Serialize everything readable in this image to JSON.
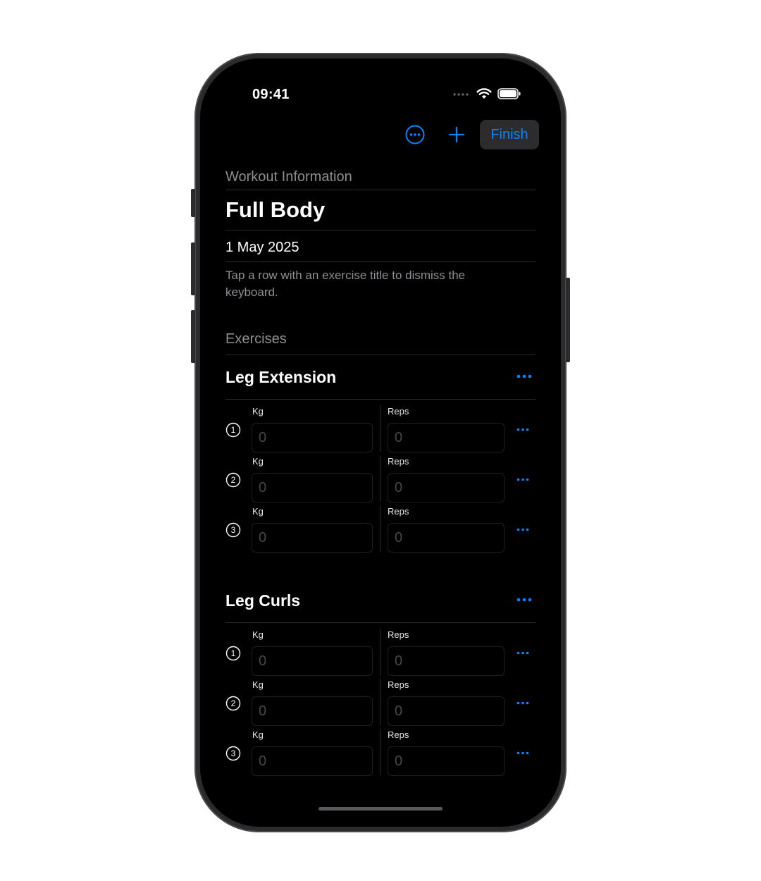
{
  "status_bar": {
    "time": "09:41"
  },
  "toolbar": {
    "finish_label": "Finish",
    "more_icon": "ellipsis-circle-icon",
    "add_icon": "plus-icon",
    "accent": "#0a84ff"
  },
  "workout": {
    "section_header": "Workout Information",
    "title": "Full Body",
    "date": "1 May 2025",
    "hint": "Tap a row with an exercise title to dismiss the keyboard."
  },
  "exercises_header": "Exercises",
  "exercises": [
    {
      "name": "Leg Extension",
      "sets": [
        {
          "number": "1",
          "kg_label": "Kg",
          "kg_placeholder": "0",
          "reps_label": "Reps",
          "reps_placeholder": "0"
        },
        {
          "number": "2",
          "kg_label": "Kg",
          "kg_placeholder": "0",
          "reps_label": "Reps",
          "reps_placeholder": "0"
        },
        {
          "number": "3",
          "kg_label": "Kg",
          "kg_placeholder": "0",
          "reps_label": "Reps",
          "reps_placeholder": "0"
        }
      ]
    },
    {
      "name": "Leg Curls",
      "sets": [
        {
          "number": "1",
          "kg_label": "Kg",
          "kg_placeholder": "0",
          "reps_label": "Reps",
          "reps_placeholder": "0"
        },
        {
          "number": "2",
          "kg_label": "Kg",
          "kg_placeholder": "0",
          "reps_label": "Reps",
          "reps_placeholder": "0"
        },
        {
          "number": "3",
          "kg_label": "Kg",
          "kg_placeholder": "0",
          "reps_label": "Reps",
          "reps_placeholder": "0"
        }
      ]
    }
  ]
}
